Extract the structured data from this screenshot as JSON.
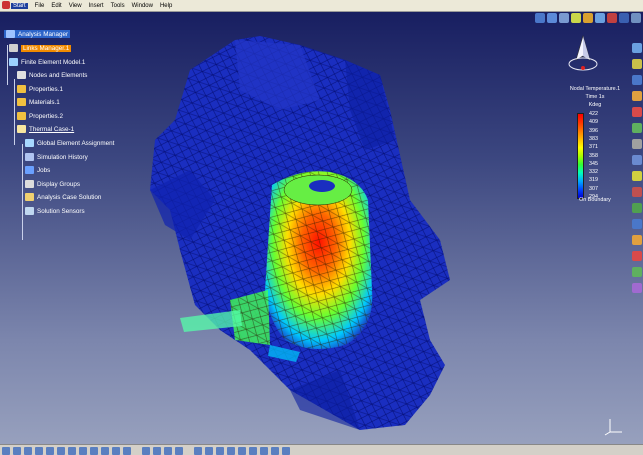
{
  "app": {
    "logo_icon": "catia-logo-icon"
  },
  "menu": {
    "items": [
      "Start",
      "File",
      "Edit",
      "View",
      "Insert",
      "Tools",
      "Window",
      "Help"
    ]
  },
  "tree": {
    "nodes": [
      {
        "label": "Analysis Manager",
        "icon": "analysis-manager-icon",
        "style": "hl"
      },
      {
        "label": "Links Manager.1",
        "icon": "links-manager-icon",
        "style": "hl2"
      },
      {
        "label": "Finite Element Model.1",
        "icon": "fem-model-icon",
        "style": ""
      },
      {
        "label": "Nodes and Elements",
        "icon": "nodes-elements-icon",
        "style": ""
      },
      {
        "label": "Properties.1",
        "icon": "folder-icon",
        "style": ""
      },
      {
        "label": "Materials.1",
        "icon": "folder-icon",
        "style": ""
      },
      {
        "label": "Properties.2",
        "icon": "folder-icon",
        "style": ""
      },
      {
        "label": "Thermal Case-1",
        "icon": "thermal-case-icon",
        "style": "ul"
      },
      {
        "label": "Global Element Assignment",
        "icon": "element-assignment-icon",
        "style": ""
      },
      {
        "label": "Simulation History",
        "icon": "history-icon",
        "style": ""
      },
      {
        "label": "Jobs",
        "icon": "jobs-icon",
        "style": ""
      },
      {
        "label": "Display Groups",
        "icon": "display-groups-icon",
        "style": ""
      },
      {
        "label": "Analysis Case Solution",
        "icon": "case-solution-icon",
        "style": ""
      },
      {
        "label": "Solution Sensors",
        "icon": "sensors-icon",
        "style": ""
      }
    ]
  },
  "legend": {
    "title": "Nodal Temperature.1",
    "time": "Time 1s",
    "unit": "Kdeg",
    "values": [
      "422",
      "409",
      "396",
      "383",
      "371",
      "358",
      "345",
      "332",
      "319",
      "307",
      "294"
    ],
    "footer": "On Boundary",
    "colors": [
      "#ff0000",
      "#ff3300",
      "#ff7700",
      "#ffbb00",
      "#ffff00",
      "#aaff00",
      "#33ff33",
      "#00ffbb",
      "#00aaff",
      "#0044ff",
      "#0000cc"
    ]
  },
  "viewport": {
    "mesh_base_color": "#1a2ec0"
  }
}
